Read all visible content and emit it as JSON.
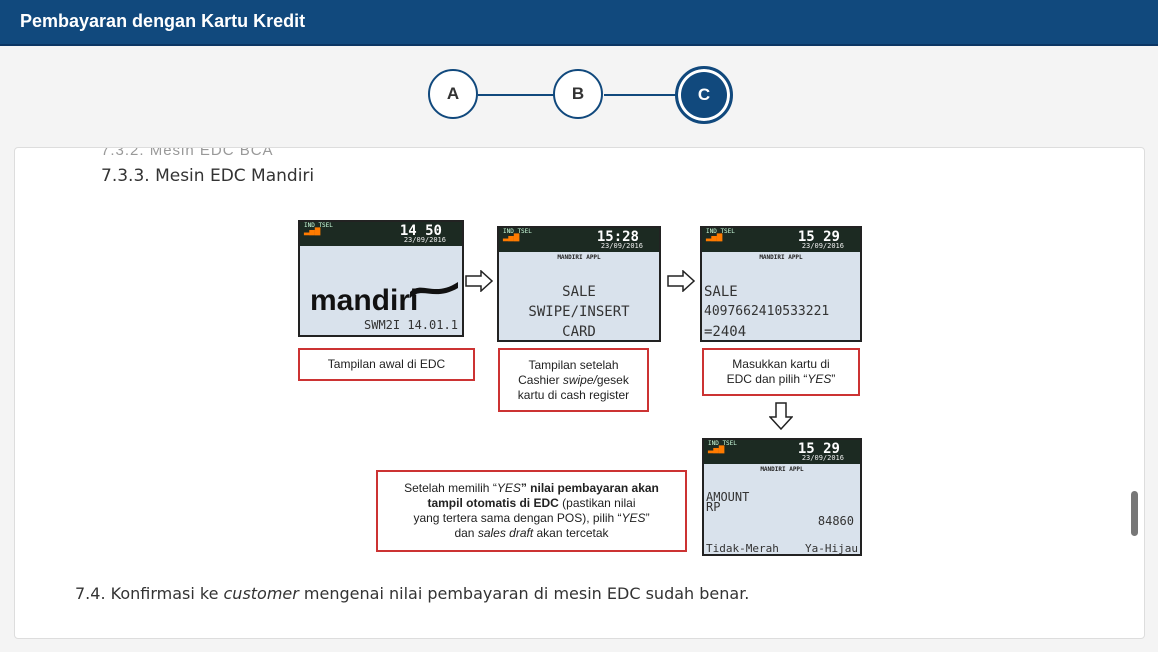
{
  "header": {
    "title": "Pembayaran dengan Kartu Kredit"
  },
  "stepper": {
    "steps": [
      {
        "label": "A"
      },
      {
        "label": "B"
      },
      {
        "label": "C"
      }
    ],
    "active": "C"
  },
  "content": {
    "cutoff_text": "7.3.2.  Mesin EDC BCA",
    "heading": "7.3.3.  Mesin EDC Mandiri",
    "screens": {
      "s1": {
        "carrier": "IND TSEL",
        "time": "14 50",
        "date": "23/09/2016",
        "logo": "mandiri",
        "version": "SWM2I 14.01.1"
      },
      "s2": {
        "carrier": "IND TSEL",
        "time": "15:28",
        "date": "23/09/2016",
        "app": "MANDIRI APPL",
        "line1": "SALE",
        "line2": "SWIPE/INSERT",
        "line3": "CARD"
      },
      "s3": {
        "carrier": "IND TSEL",
        "time": "15 29",
        "date": "23/09/2016",
        "app": "MANDIRI APPL",
        "line1": "SALE",
        "line2": "4097662410533221",
        "line3": "=2404"
      },
      "s4": {
        "carrier": "IND TSEL",
        "time": "15 29",
        "date": "23/09/2016",
        "app": "MANDIRI APPL",
        "line1": "AMOUNT",
        "line2": "RP",
        "amount": "84860",
        "left_opt": "Tidak-Merah",
        "right_opt": "Ya-Hijau"
      }
    },
    "captions": {
      "c1": "Tampilan awal di EDC",
      "c2_a": "Tampilan setelah",
      "c2_b_pre": "Cashier ",
      "c2_b_em": "swipe/",
      "c2_b_post": "gesek",
      "c2_c": "kartu di cash register",
      "c3_a": "Masukkan kartu di",
      "c3_b_pre": "EDC dan pilih “",
      "c3_b_em": "YES",
      "c3_b_post": "”",
      "c4_a_pre": "Setelah memilih “",
      "c4_a_em": "YES",
      "c4_a_post": "” nilai pembayaran akan",
      "c4_b": "tampil otomatis di EDC",
      "c4_b_post": " (pastikan nilai",
      "c4_c_pre": "yang tertera sama dengan POS), pilih “",
      "c4_c_em": "YES",
      "c4_c_post": "”",
      "c4_d_pre": "dan ",
      "c4_d_em": "sales draft",
      "c4_d_post": " akan tercetak"
    },
    "footer": {
      "pre": "7.4.  Konfirmasi ke ",
      "em": "customer",
      "post": " mengenai nilai pembayaran di mesin EDC sudah benar."
    }
  },
  "colors": {
    "header": "#11497d",
    "caption_border": "#cc3333",
    "card": "#ffffff"
  }
}
